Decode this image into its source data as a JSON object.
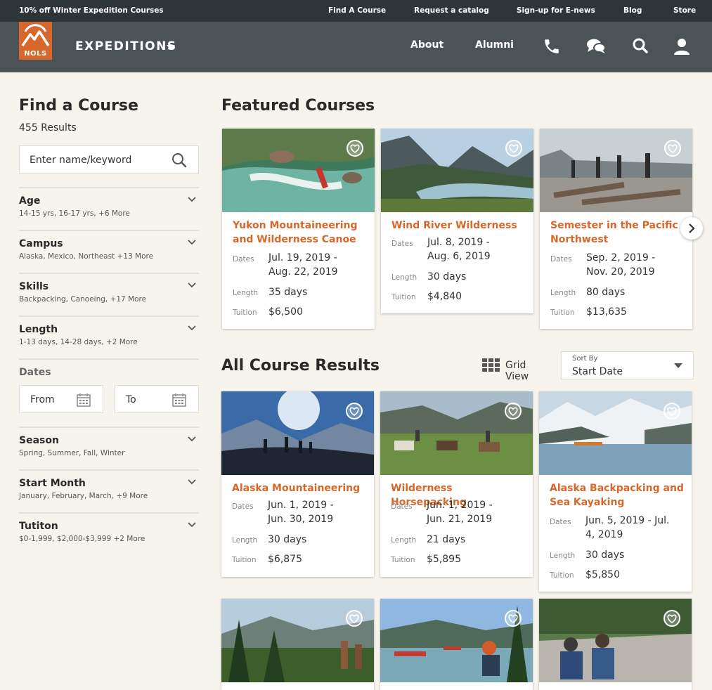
{
  "topbar": {
    "promo": "10% off Winter Expedition Courses",
    "links": [
      "Find A Course",
      "Request a catalog",
      "Sign-up for E-news",
      "Blog",
      "Store"
    ]
  },
  "header": {
    "logo_text": "NOLS",
    "section": "EXPEDITIONS",
    "nav": [
      "About",
      "Alumni"
    ],
    "icons": [
      "phone-icon",
      "chat-icon",
      "search-icon",
      "user-icon"
    ]
  },
  "sidebar": {
    "title": "Find a Course",
    "results": "455 Results",
    "search_placeholder": "Enter name/keyword",
    "filters": [
      {
        "title": "Age",
        "summary": "14-15 yrs, 16-17 yrs, +6 More"
      },
      {
        "title": "Campus",
        "summary": "Alaska, Mexico, Northeast +13 More"
      },
      {
        "title": "Skills",
        "summary": "Backpacking, Canoeing, +17 More"
      },
      {
        "title": "Length",
        "summary": "1-13 days, 14-28 days, +2 More"
      }
    ],
    "dates": {
      "title": "Dates",
      "from": "From",
      "to": "To"
    },
    "filters2": [
      {
        "title": "Season",
        "summary": "Spring, Summer, Fall, Winter"
      },
      {
        "title": "Start Month",
        "summary": "January, February, March, +9 More"
      },
      {
        "title": "Tutiton",
        "summary": "$0-1,999, $2,000-$3,999 +2 More"
      }
    ]
  },
  "labels": {
    "dates": "Dates",
    "length": "Length",
    "tuition": "Tuition"
  },
  "featured": {
    "title": "Featured Courses",
    "courses": [
      {
        "title": "Yukon Mountaineering and Wilderness Canoe",
        "dates": "Jul. 19, 2019 - Aug. 22, 2019",
        "length": "35 days",
        "tuition": "$6,500"
      },
      {
        "title": "Wind River Wilderness",
        "dates": "Jul. 8, 2019 - Aug. 6, 2019",
        "length": "30 days",
        "tuition": "$4,840"
      },
      {
        "title": "Semester in the Pacific Northwest",
        "dates": "Sep. 2, 2019 - Nov. 20, 2019",
        "length": "80 days",
        "tuition": "$13,635"
      }
    ]
  },
  "all_results": {
    "title": "All Course Results",
    "grid_view": "Grid View",
    "sort_label": "Sort By",
    "sort_value": "Start Date",
    "courses": [
      {
        "title": "Alaska Mountaineering",
        "dates": "Jun. 1, 2019 - Jun. 30, 2019",
        "length": "30 days",
        "tuition": "$6,875"
      },
      {
        "title": "Wilderness Horsepacking",
        "dates": "Jun. 1, 2019 - Jun. 21, 2019",
        "length": "21 days",
        "tuition": "$5,895"
      },
      {
        "title": "Alaska Backpacking and Sea Kayaking",
        "dates": "Jun. 5, 2019 - Jul. 4, 2019",
        "length": "30 days",
        "tuition": "$5,850"
      }
    ]
  },
  "colors": {
    "accent": "#d8672b",
    "topbar": "#2e3539",
    "header": "#4b5356",
    "background": "#f6f4ed"
  }
}
